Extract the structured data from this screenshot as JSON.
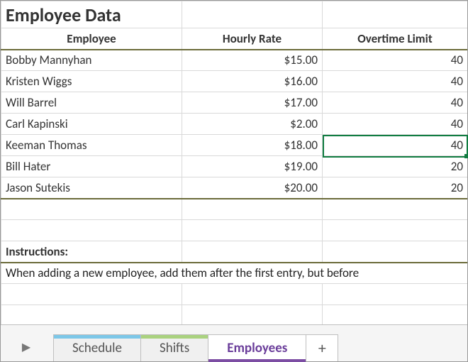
{
  "title": "Employee Data",
  "headers": {
    "employee": "Employee",
    "rate": "Hourly Rate",
    "ot": "Overtime Limit"
  },
  "rows": [
    {
      "name": "Bobby Mannyhan",
      "rate": "$15.00",
      "ot": "40"
    },
    {
      "name": "Kristen Wiggs",
      "rate": "$16.00",
      "ot": "40"
    },
    {
      "name": "Will Barrel",
      "rate": "$17.00",
      "ot": "40"
    },
    {
      "name": "Carl Kapinski",
      "rate": "$2.00",
      "ot": "40"
    },
    {
      "name": "Keeman Thomas",
      "rate": "$18.00",
      "ot": "40"
    },
    {
      "name": "Bill Hater",
      "rate": "$19.00",
      "ot": "20"
    },
    {
      "name": "Jason Sutekis",
      "rate": "$20.00",
      "ot": "20"
    }
  ],
  "instructions_label": "Instructions:",
  "instructions_text": "When adding a new employee, add them after the first entry, but before",
  "tabs": {
    "schedule": "Schedule",
    "shifts": "Shifts",
    "employees": "Employees",
    "add": "+"
  },
  "nav_glyph": "▶",
  "selected_cell": {
    "row_index": 4,
    "col": "ot"
  },
  "chart_data": {
    "type": "table",
    "title": "Employee Data",
    "columns": [
      "Employee",
      "Hourly Rate",
      "Overtime Limit"
    ],
    "rows": [
      [
        "Bobby Mannyhan",
        15.0,
        40
      ],
      [
        "Kristen Wiggs",
        16.0,
        40
      ],
      [
        "Will Barrel",
        17.0,
        40
      ],
      [
        "Carl Kapinski",
        2.0,
        40
      ],
      [
        "Keeman Thomas",
        18.0,
        40
      ],
      [
        "Bill Hater",
        19.0,
        20
      ],
      [
        "Jason Sutekis",
        20.0,
        20
      ]
    ]
  }
}
